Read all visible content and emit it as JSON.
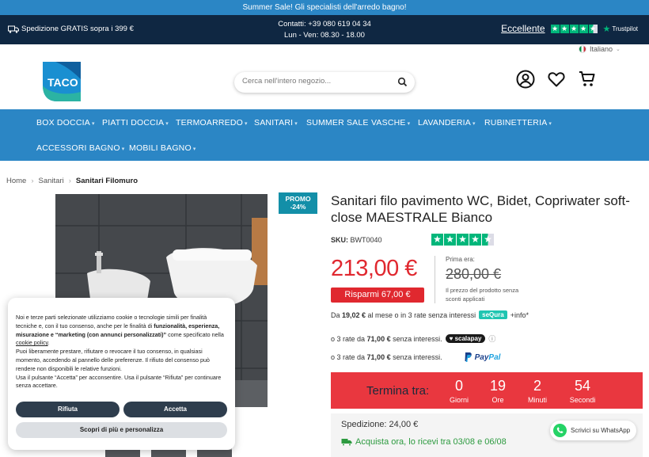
{
  "topbar": {
    "text": "Summer Sale! Gli specialisti dell'arredo bagno!"
  },
  "infobar": {
    "shipping": "Spedizione GRATIS sopra i 399 €",
    "contacts": "Contatti: +39 080 619 04 34",
    "hours": "Lun - Ven: 08.30 - 18.00",
    "rating_word": "Eccellente",
    "trustpilot": "Trustpilot",
    "rating_stars": 4.5
  },
  "header": {
    "logo_text": "TACO",
    "language": "Italiano",
    "search_placeholder": "Cerca nell'intero negozio...",
    "icons": [
      "account-icon",
      "heart-icon",
      "cart-icon"
    ]
  },
  "nav": {
    "items": [
      {
        "label": "BOX DOCCIA"
      },
      {
        "label": "PIATTI DOCCIA"
      },
      {
        "label": "TERMOARREDO"
      },
      {
        "label": "SANITARI"
      },
      {
        "label": "SUMMER SALE"
      },
      {
        "label": "VASCHE"
      },
      {
        "label": "LAVANDERIA"
      },
      {
        "label": "RUBINETTERIA"
      },
      {
        "label": "ACCESSORI BAGNO"
      },
      {
        "label": "MOBILI BAGNO"
      }
    ]
  },
  "breadcrumb": {
    "home": "Home",
    "category": "Sanitari",
    "current": "Sanitari Filomuro"
  },
  "product": {
    "promo_label": "PROMO",
    "promo_pct": "-24%",
    "title": "Sanitari filo pavimento WC, Bidet, Copriwater soft-close MAESTRALE Bianco",
    "sku_label": "SKU:",
    "sku": "BWT0040",
    "rating_stars": 4.5,
    "price": "213,00 €",
    "savings": "Risparmi 67,00 €",
    "prev_label": "Prima era:",
    "prev_price": "280,00 €",
    "prev_note": "Il prezzo del prodotto senza sconti applicati"
  },
  "payments": {
    "sequra": {
      "prefix": "Da ",
      "amount": "19,02 €",
      "suffix": " al mese o in 3 rate senza interessi",
      "badge": "seQura",
      "info": "+info*"
    },
    "scalapay": {
      "prefix": "o 3 rate da ",
      "amount": "71,00 €",
      "suffix": " senza interessi.",
      "badge": "♥ scalapay",
      "info": "ⓘ"
    },
    "paypal": {
      "prefix": "o 3 rate da ",
      "amount": "71,00 €",
      "suffix": " senza interessi.",
      "brand_a": "Pay",
      "brand_b": "Pal"
    }
  },
  "timer": {
    "label": "Termina tra:",
    "units": [
      {
        "value": "0",
        "unit": "Giorni"
      },
      {
        "value": "19",
        "unit": "Ore"
      },
      {
        "value": "2",
        "unit": "Minuti"
      },
      {
        "value": "54",
        "unit": "Secondi"
      }
    ]
  },
  "shipping": {
    "cost": "Spedizione: 24,00 €",
    "delivery": "Acquista ora, lo ricevi tra 03/08 e 06/08"
  },
  "whatsapp": {
    "label": "Scrivici su WhatsApp"
  },
  "cookie": {
    "p1a": "Noi e terze parti selezionate utilizziamo cookie o tecnologie simili per finalità tecniche e, con il tuo consenso, anche per le finalità di ",
    "p1b": "funzionalità, esperienza, misurazione e “marketing (con annunci personalizzati)”",
    "p1c": " come specificato nella ",
    "p1link": "cookie policy",
    "p1d": ".",
    "p2": "Puoi liberamente prestare, rifiutare o revocare il tuo consenso, in qualsiasi momento, accedendo al pannello delle preferenze. Il rifiuto del consenso può rendere non disponibili le relative funzioni.",
    "p3": "Usa il pulsante “Accetta” per acconsentire. Usa il pulsante “Rifiuta” per continuare senza accettare.",
    "reject": "Rifiuta",
    "accept": "Accetta",
    "more": "Scopri di più e personalizza"
  }
}
